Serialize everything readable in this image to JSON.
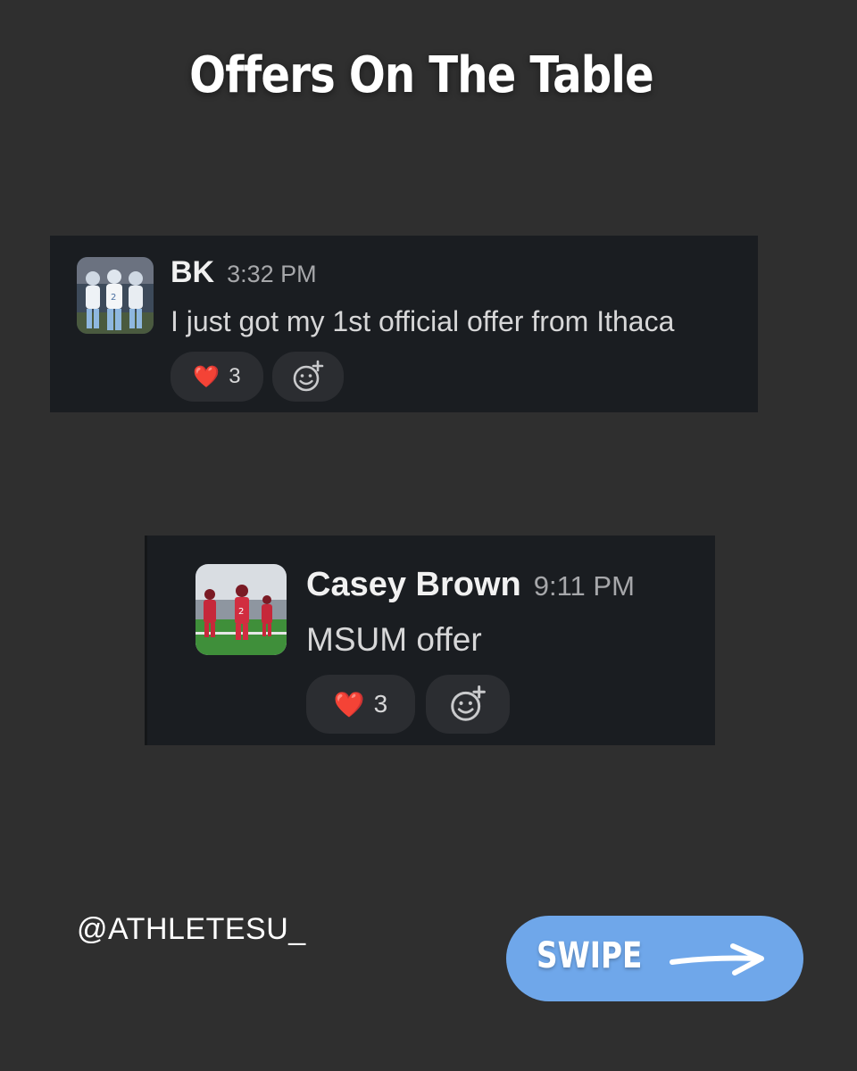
{
  "page": {
    "title": "Offers On The Table"
  },
  "messages": [
    {
      "author": "BK",
      "time": "3:32 PM",
      "text": "I just got my 1st official offer from Ithaca",
      "avatar_icon": "football-team-photo-avatar",
      "reactions": {
        "heart_emoji": "❤️",
        "heart_count": "3",
        "add_icon": "add-reaction-icon"
      }
    },
    {
      "author": "Casey Brown",
      "time": "9:11 PM",
      "text": "MSUM offer",
      "avatar_icon": "football-field-photo-avatar",
      "reactions": {
        "heart_emoji": "❤️",
        "heart_count": "3",
        "add_icon": "add-reaction-icon"
      }
    }
  ],
  "footer": {
    "handle": "@ATHLETESU_",
    "swipe_label": "SWIPE",
    "swipe_icon": "arrow-right-icon"
  },
  "colors": {
    "background": "#2f2f2f",
    "card": "#1a1d21",
    "reaction_pill": "#2b2d31",
    "swipe_button": "#6fa7ea",
    "heart": "#e0192f"
  }
}
